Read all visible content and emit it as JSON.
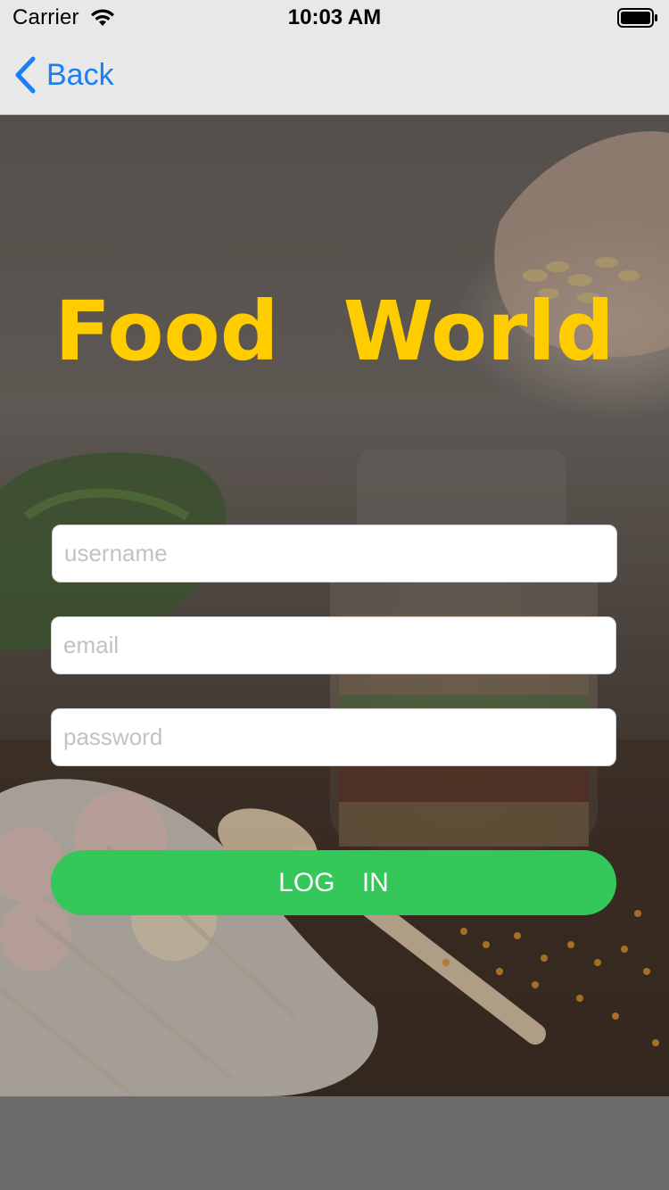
{
  "status_bar": {
    "carrier": "Carrier",
    "time": "10:03 AM",
    "icons": [
      "wifi-icon",
      "battery-icon"
    ]
  },
  "nav": {
    "back_label": "Back",
    "back_icon": "chevron-left-icon",
    "tint_color": "#1a7ff5"
  },
  "main": {
    "title": "Food World",
    "title_color": "#ffcc00",
    "username_placeholder": "username",
    "email_placeholder": "email",
    "password_placeholder": "password",
    "login_label": "LOG IN",
    "login_color": "#34c759"
  }
}
